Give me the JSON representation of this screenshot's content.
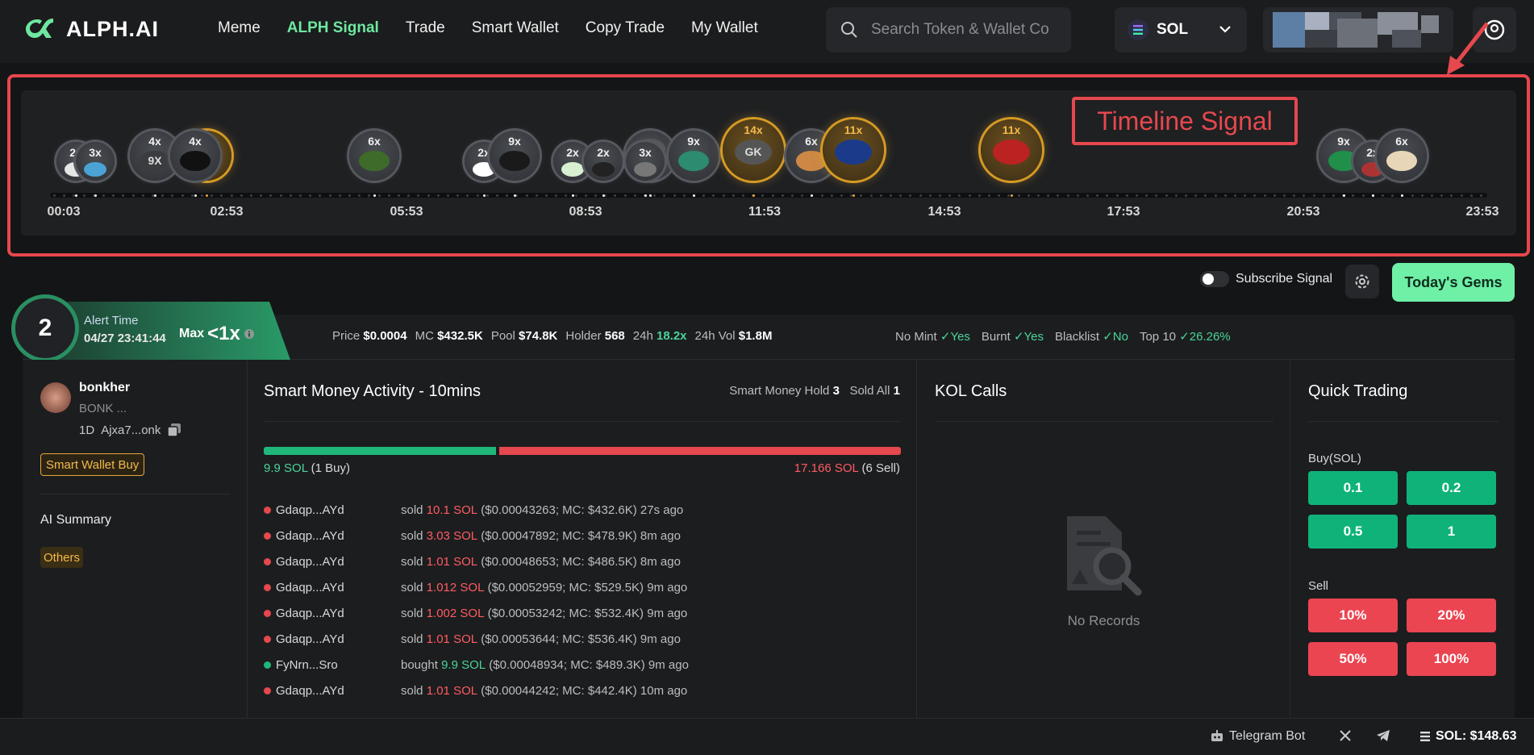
{
  "header": {
    "logo_text": "ALPH.AI",
    "nav": [
      {
        "label": "Meme",
        "active": false
      },
      {
        "label": "ALPH Signal",
        "active": true
      },
      {
        "label": "Trade",
        "active": false
      },
      {
        "label": "Smart Wallet",
        "active": false
      },
      {
        "label": "Copy Trade",
        "active": false
      },
      {
        "label": "My Wallet",
        "active": false
      }
    ],
    "search_placeholder": "Search Token & Wallet Contract",
    "chain": "SOL"
  },
  "timeline": {
    "annotation": "Timeline Signal",
    "times": [
      "00:03",
      "02:53",
      "05:53",
      "08:53",
      "11:53",
      "14:53",
      "17:53",
      "20:53",
      "23:53"
    ],
    "bubbles": [
      {
        "m": "2x",
        "face": "",
        "kind": "grey",
        "size": "sm"
      },
      {
        "m": "3x",
        "face": "",
        "kind": "grey",
        "size": "sm"
      },
      {
        "m": "4x",
        "face": "9X",
        "kind": "grey",
        "size": "md"
      },
      {
        "m": "",
        "face": "",
        "kind": "gold",
        "size": "md"
      },
      {
        "m": "4x",
        "face": "",
        "kind": "grey",
        "size": "md"
      },
      {
        "m": "6x",
        "face": "",
        "kind": "grey",
        "size": "md"
      },
      {
        "m": "2x",
        "face": "",
        "kind": "grey",
        "size": "sm"
      },
      {
        "m": "9x",
        "face": "",
        "kind": "grey",
        "size": "md"
      },
      {
        "m": "2x",
        "face": "",
        "kind": "grey",
        "size": "sm"
      },
      {
        "m": "2x",
        "face": "",
        "kind": "grey",
        "size": "sm"
      },
      {
        "m": "",
        "face": "",
        "kind": "grey",
        "size": "md"
      },
      {
        "m": "3x",
        "face": "",
        "kind": "grey",
        "size": "sm"
      },
      {
        "m": "9x",
        "face": "",
        "kind": "grey",
        "size": "md"
      },
      {
        "m": "14x",
        "face": "GK",
        "kind": "gold",
        "size": "lg"
      },
      {
        "m": "6x",
        "face": "",
        "kind": "grey",
        "size": "md"
      },
      {
        "m": "11x",
        "face": "",
        "kind": "gold",
        "size": "lg"
      },
      {
        "m": "11x",
        "face": "",
        "kind": "gold",
        "size": "lg"
      },
      {
        "m": "9x",
        "face": "",
        "kind": "grey",
        "size": "md"
      },
      {
        "m": "2x",
        "face": "",
        "kind": "grey",
        "size": "sm"
      },
      {
        "m": "6x",
        "face": "",
        "kind": "grey",
        "size": "md"
      }
    ]
  },
  "controls": {
    "subscribe_label": "Subscribe Signal",
    "gems_label": "Today's Gems"
  },
  "alert": {
    "rank": "2",
    "label": "Alert Time",
    "time": "04/27 23:41:44",
    "max_label": "Max",
    "max_value": "<1x"
  },
  "stats": {
    "price_label": "Price",
    "price": "$0.0004",
    "mc_label": "MC",
    "mc": "$432.5K",
    "pool_label": "Pool",
    "pool": "$74.8K",
    "holder_label": "Holder",
    "holder": "568",
    "h24_label": "24h",
    "h24": "18.2x",
    "vol_label": "24h Vol",
    "vol": "$1.8M",
    "nomint_label": "No Mint",
    "nomint": "Yes",
    "burnt_label": "Burnt",
    "burnt": "Yes",
    "blacklist_label": "Blacklist",
    "blacklist": "No",
    "top10_label": "Top 10",
    "top10": "26.26%"
  },
  "token": {
    "name": "bonkher",
    "symbol": "BONK ...",
    "age": "1D",
    "address": "Ajxa7...onk",
    "tag": "Smart Wallet Buy",
    "ai_summary_label": "AI Summary",
    "category": "Others"
  },
  "smart_money": {
    "title": "Smart Money Activity - 10mins",
    "hold_label": "Smart Money Hold",
    "hold": "3",
    "sold_all_label": "Sold All",
    "sold_all": "1",
    "buy_sol": "9.9 SOL",
    "buy_count": "(1 Buy)",
    "sell_sol": "17.166 SOL",
    "sell_count": "(6 Sell)",
    "buy_ratio": 0.366,
    "activities": [
      {
        "wallet": "Gdaqp...AYd",
        "action": "sold",
        "amount": "10.1 SOL",
        "detail": "($0.00043263; MC: $432.6K) 27s ago",
        "side": "sell"
      },
      {
        "wallet": "Gdaqp...AYd",
        "action": "sold",
        "amount": "3.03 SOL",
        "detail": "($0.00047892; MC: $478.9K) 8m ago",
        "side": "sell"
      },
      {
        "wallet": "Gdaqp...AYd",
        "action": "sold",
        "amount": "1.01 SOL",
        "detail": "($0.00048653; MC: $486.5K) 8m ago",
        "side": "sell"
      },
      {
        "wallet": "Gdaqp...AYd",
        "action": "sold",
        "amount": "1.012 SOL",
        "detail": "($0.00052959; MC: $529.5K) 9m ago",
        "side": "sell"
      },
      {
        "wallet": "Gdaqp...AYd",
        "action": "sold",
        "amount": "1.002 SOL",
        "detail": "($0.00053242; MC: $532.4K) 9m ago",
        "side": "sell"
      },
      {
        "wallet": "Gdaqp...AYd",
        "action": "sold",
        "amount": "1.01 SOL",
        "detail": "($0.00053644; MC: $536.4K) 9m ago",
        "side": "sell"
      },
      {
        "wallet": "FyNrn...Sro",
        "action": "bought",
        "amount": "9.9 SOL",
        "detail": "($0.00048934; MC: $489.3K) 9m ago",
        "side": "buy"
      },
      {
        "wallet": "Gdaqp...AYd",
        "action": "sold",
        "amount": "1.01 SOL",
        "detail": "($0.00044242; MC: $442.4K) 10m ago",
        "side": "sell"
      }
    ]
  },
  "kol": {
    "title": "KOL Calls",
    "empty": "No Records"
  },
  "quick": {
    "title": "Quick Trading",
    "buy_label": "Buy(SOL)",
    "buy": [
      "0.1",
      "0.2",
      "0.5",
      "1"
    ],
    "sell_label": "Sell",
    "sell": [
      "10%",
      "20%",
      "50%",
      "100%"
    ]
  },
  "footer": {
    "telegram": "Telegram Bot",
    "sol_price": "SOL: $148.63"
  },
  "colors": {
    "accent_green": "#6ee7a0",
    "buy": "#0fb37a",
    "sell": "#eb4551",
    "highlight": "#e5484d",
    "gold": "#e8a73a"
  }
}
